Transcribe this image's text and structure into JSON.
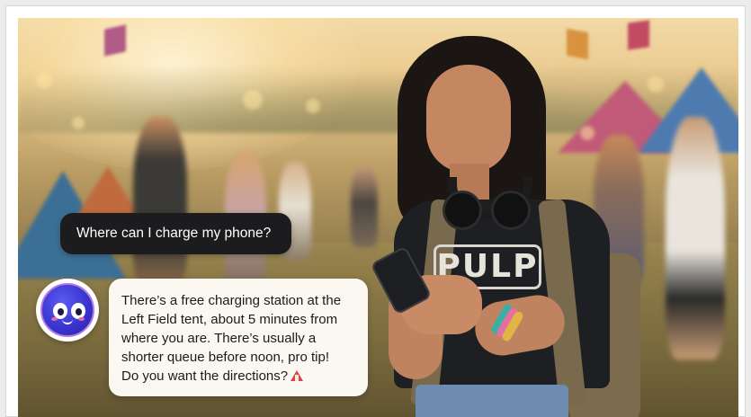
{
  "chat": {
    "user_message": "Where can I charge my phone?",
    "assistant_lines": [
      "There’s a free charging station at the",
      "Left Field tent, about 5 minutes from",
      "where you are. There’s usually a",
      "shorter queue before noon, pro tip!",
      "Do you want the directions?"
    ],
    "assistant_trailing_icon": "circus-tent-icon",
    "assistant_avatar_icon": "smiling-blob-avatar-icon"
  },
  "photo": {
    "shirt_logo": "PULP"
  },
  "colors": {
    "user_bubble_bg": "#1c1c1e",
    "user_bubble_text": "#ffffff",
    "assistant_bubble_bg": "#fbf8f2",
    "assistant_bubble_text": "#1b1b1b",
    "avatar_fill": "#3a35d0",
    "avatar_ring": "#b27adf"
  }
}
